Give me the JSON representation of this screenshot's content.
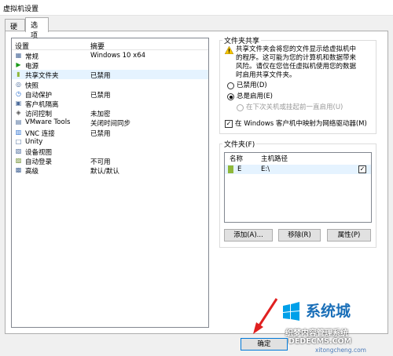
{
  "window": {
    "title": "虚拟机设置"
  },
  "tabs": [
    {
      "label": "硬件"
    },
    {
      "label": "选项"
    }
  ],
  "list": {
    "headers": {
      "setting": "设置",
      "summary": "摘要"
    },
    "rows": [
      {
        "name": "常规",
        "value": "Windows 10 x64",
        "icon": "general-icon"
      },
      {
        "name": "电源",
        "value": "",
        "icon": "power-icon"
      },
      {
        "name": "共享文件夹",
        "value": "已禁用",
        "icon": "shared-folder-icon"
      },
      {
        "name": "快照",
        "value": "",
        "icon": "snapshot-icon"
      },
      {
        "name": "自动保护",
        "value": "已禁用",
        "icon": "autoprotect-icon"
      },
      {
        "name": "客户机隔离",
        "value": "",
        "icon": "isolation-icon"
      },
      {
        "name": "访问控制",
        "value": "未加密",
        "icon": "access-control-icon"
      },
      {
        "name": "VMware Tools",
        "value": "关闭时间同步",
        "icon": "vmware-tools-icon"
      },
      {
        "name": "VNC 连接",
        "value": "已禁用",
        "icon": "vnc-icon"
      },
      {
        "name": "Unity",
        "value": "",
        "icon": "unity-icon"
      },
      {
        "name": "设备视图",
        "value": "",
        "icon": "device-view-icon"
      },
      {
        "name": "自动登录",
        "value": "不可用",
        "icon": "autologin-icon"
      },
      {
        "name": "高级",
        "value": "默认/默认",
        "icon": "advanced-icon"
      }
    ]
  },
  "sharing": {
    "title": "文件夹共享",
    "warning_lines": [
      "共享文件夹会将您的文件显示给虚拟机中",
      "的程序。这可能为您的计算机和数据带来",
      "风险。请仅在您信任虚拟机使用您的数据",
      "时启用共享文件夹。"
    ],
    "opt_disabled": "已禁用(D)",
    "opt_always": "总是启用(E)",
    "opt_until": "在下次关机或挂起前一直启用(U)",
    "map_drive": "在 Windows 客户机中映射为网络驱动器(M)"
  },
  "folders": {
    "title": "文件夹(F)",
    "col_name": "名称",
    "col_path": "主机路径",
    "row_name": "E",
    "row_path": "E:\\",
    "add": "添加(A)...",
    "remove": "移除(R)",
    "properties": "属性(P)"
  },
  "ok_label": "确定",
  "watermark": {
    "site": "系统城",
    "line1": "织梦内容管理系统",
    "line2": "DEDECMS.COM",
    "line3": "xitongcheng.com"
  }
}
